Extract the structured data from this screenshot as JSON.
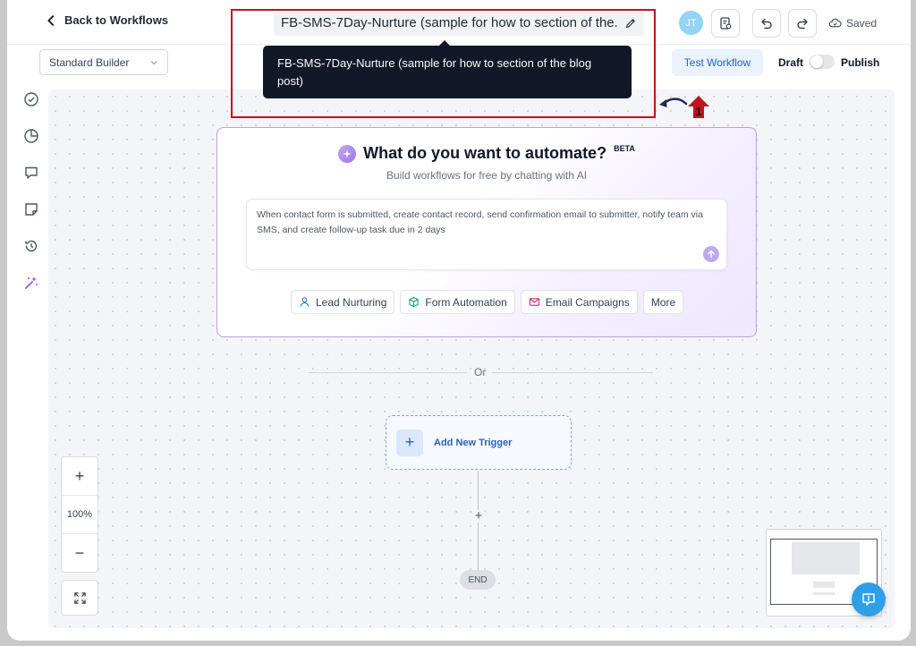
{
  "header": {
    "back_label": "Back to Workflows",
    "workflow_title_truncated": "FB-SMS-7Day-Nurture (sample for how to section of the...",
    "avatar_initials": "JT",
    "saved_label": "Saved"
  },
  "toolbar": {
    "builder_select_value": "Standard Builder",
    "test_workflow_label": "Test Workflow",
    "draft_label": "Draft",
    "publish_label": "Publish"
  },
  "tooltip": {
    "text": "FB-SMS-7Day-Nurture (sample for how to section of the blog post)"
  },
  "annotation": {
    "badge_number": "1",
    "highlight_color": "#c0161b"
  },
  "ai_builder": {
    "title": "What do you want to automate?",
    "beta_tag": "BETA",
    "subtitle": "Build workflows for free by chatting with AI",
    "prompt_text": "When contact form is submitted, create contact record, send confirmation email to submitter, notify team via SMS, and create follow-up task due in 2 days",
    "chips": [
      {
        "label": "Lead Nurturing",
        "icon": "user-icon"
      },
      {
        "label": "Form Automation",
        "icon": "cube-icon"
      },
      {
        "label": "Email Campaigns",
        "icon": "mail-icon"
      },
      {
        "label": "More",
        "icon": ""
      }
    ]
  },
  "canvas": {
    "divider_label": "Or",
    "add_trigger_label": "Add New Trigger",
    "end_label": "END",
    "zoom_level": "100%"
  },
  "colors": {
    "accent_blue": "#2563c9",
    "ai_purple": "#9b76e6",
    "help_blue": "#2f9fe8"
  }
}
